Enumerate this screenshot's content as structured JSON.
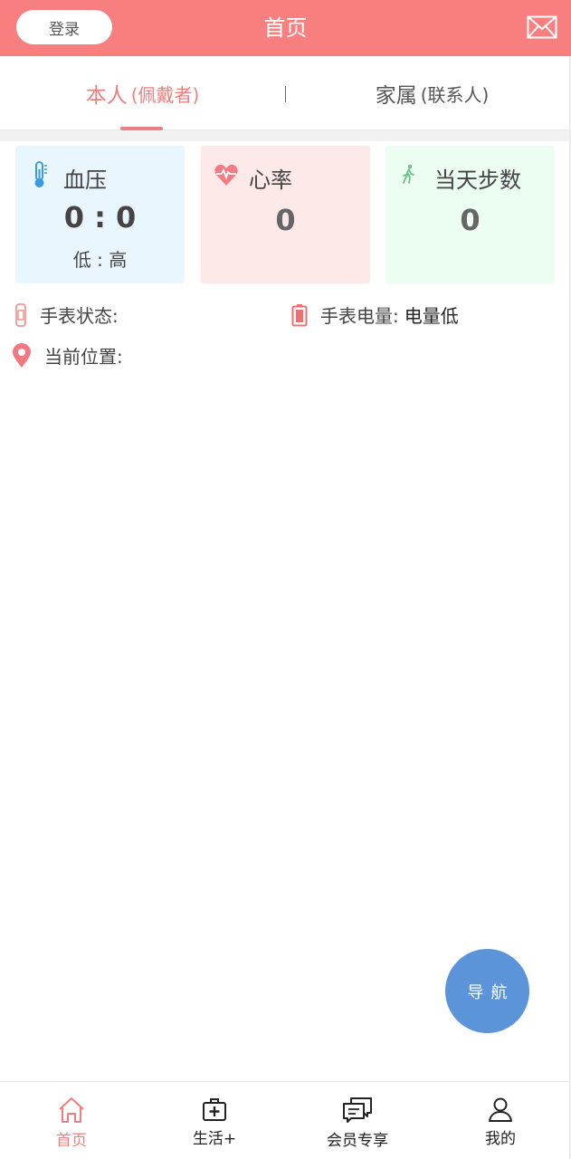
{
  "header": {
    "login_label": "登录",
    "title": "首页",
    "mail_icon": "mail-icon"
  },
  "tabs": {
    "self": {
      "label": "本人",
      "sub": "(佩戴者)"
    },
    "family": {
      "label": "家属",
      "sub": "(联系人)"
    }
  },
  "cards": {
    "blood_pressure": {
      "title": "血压",
      "value": "0 : 0",
      "sub": "低 : 高",
      "icon": "thermometer-icon"
    },
    "heart_rate": {
      "title": "心率",
      "value": "0",
      "icon": "heart-pulse-icon"
    },
    "steps": {
      "title": "当天步数",
      "value": "0",
      "icon": "walking-icon"
    }
  },
  "status": {
    "watch_state_label": "手表状态:",
    "battery_label": "手表电量:",
    "battery_value": "电量低",
    "location_label": "当前位置:"
  },
  "fab": {
    "label": "导航"
  },
  "bottom_nav": [
    {
      "label": "首页",
      "icon": "home-icon"
    },
    {
      "label": "生活+",
      "icon": "medical-kit-icon"
    },
    {
      "label": "会员专享",
      "icon": "chat-icon"
    },
    {
      "label": "我的",
      "icon": "user-icon"
    }
  ],
  "colors": {
    "accent": "#f77f7f",
    "fab": "#5b94d8"
  }
}
